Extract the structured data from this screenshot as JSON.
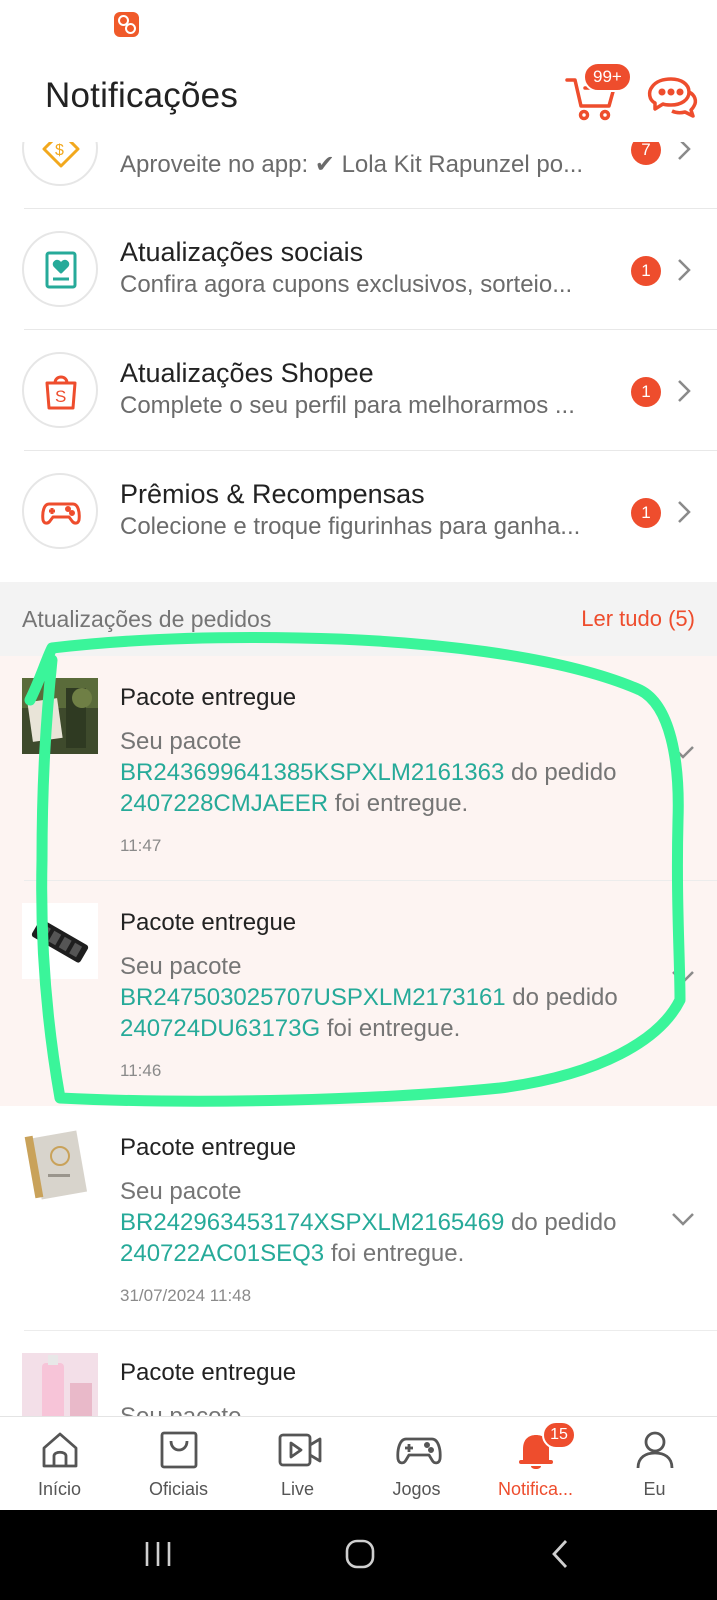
{
  "header": {
    "title": "Notificações",
    "cart_badge": "99+",
    "cart_icon": "cart-icon",
    "chat_icon": "chat-icon"
  },
  "categories": [
    {
      "title": "",
      "description": "Aproveite no app: ✔ Lola Kit Rapunzel po...",
      "badge": "7",
      "icon": "promo-voucher-icon"
    },
    {
      "title": "Atualizações sociais",
      "description": "Confira agora cupons exclusivos, sorteio...",
      "badge": "1",
      "icon": "social-heart-icon"
    },
    {
      "title": "Atualizações Shopee",
      "description": "Complete o seu perfil para melhorarmos ...",
      "badge": "1",
      "icon": "shopee-bag-icon"
    },
    {
      "title": "Prêmios & Recompensas",
      "description": "Colecione e troque figurinhas para ganha...",
      "badge": "1",
      "icon": "gamepad-icon"
    }
  ],
  "orders_section": {
    "title": "Atualizações de pedidos",
    "read_all": "Ler tudo (5)"
  },
  "orders": [
    {
      "title": "Pacote entregue",
      "prefix": "Seu pacote",
      "tracking": "BR243699641385KSPXLM2161363",
      "mid": " do pedido ",
      "order_id": "2407228CMJAEER",
      "suffix": " foi entregue.",
      "time": "11:47"
    },
    {
      "title": "Pacote entregue",
      "prefix": "Seu pacote",
      "tracking": "BR247503025707USPXLM2173161",
      "mid": " do pedido ",
      "order_id": "240724DU63173G",
      "suffix": " foi entregue.",
      "time": "11:46"
    },
    {
      "title": "Pacote entregue",
      "prefix": "Seu pacote",
      "tracking": "BR242963453174XSPXLM2165469",
      "mid": " do pedido ",
      "order_id": "240722AC01SEQ3",
      "suffix": " foi entregue.",
      "time": "31/07/2024 11:48"
    },
    {
      "title": "Pacote entregue",
      "prefix": "Seu pacote",
      "tracking": "",
      "mid": "",
      "order_id": "",
      "suffix": "",
      "time": ""
    }
  ],
  "bottom_nav": {
    "items": [
      {
        "label": "Início",
        "icon": "home-icon"
      },
      {
        "label": "Oficiais",
        "icon": "mall-bag-icon"
      },
      {
        "label": "Live",
        "icon": "live-video-icon"
      },
      {
        "label": "Jogos",
        "icon": "games-icon"
      },
      {
        "label": "Notifica...",
        "icon": "bell-icon",
        "badge": "15"
      },
      {
        "label": "Eu",
        "icon": "profile-icon"
      }
    ]
  },
  "colors": {
    "brand": "#ee4d2d",
    "link": "#26aa99",
    "annotation": "#3af59a"
  }
}
